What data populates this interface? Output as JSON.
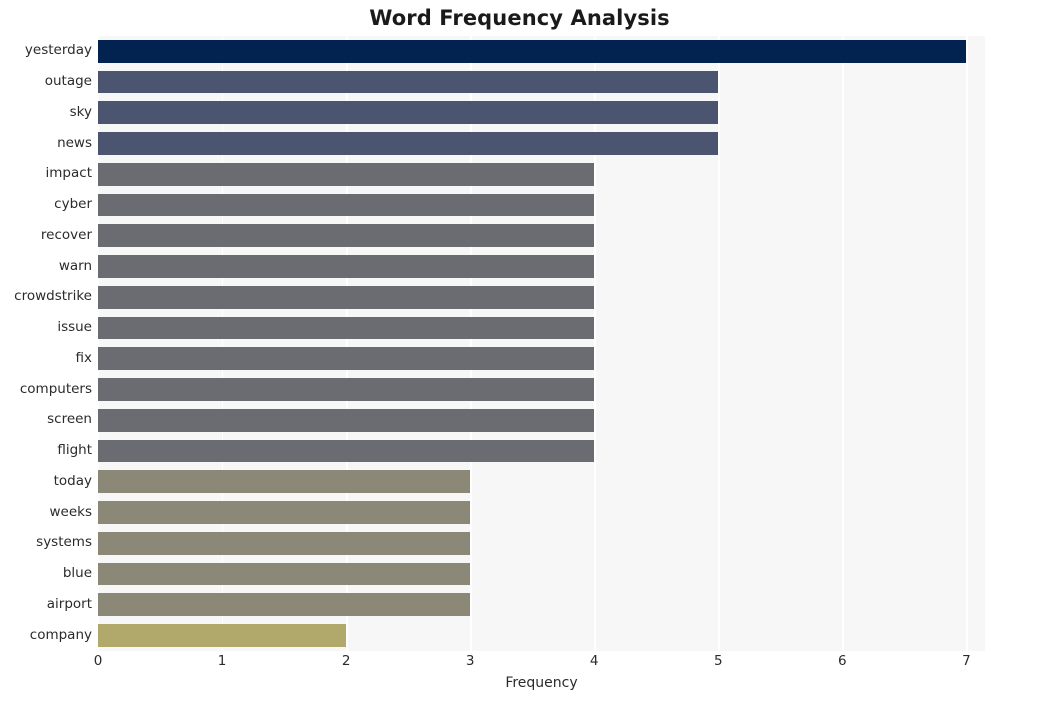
{
  "chart_data": {
    "type": "bar",
    "orientation": "horizontal",
    "title": "Word Frequency Analysis",
    "xlabel": "Frequency",
    "ylabel": "",
    "xlim": [
      0,
      7.15
    ],
    "xticks": [
      "0",
      "1",
      "2",
      "3",
      "4",
      "5",
      "6",
      "7"
    ],
    "xtick_values": [
      0,
      1,
      2,
      3,
      4,
      5,
      6,
      7
    ],
    "grid": "vertical-white",
    "legend": "none",
    "plot_background": "#f7f7f7",
    "categories": [
      "yesterday",
      "outage",
      "sky",
      "news",
      "impact",
      "cyber",
      "recover",
      "warn",
      "crowdstrike",
      "issue",
      "fix",
      "computers",
      "screen",
      "flight",
      "today",
      "weeks",
      "systems",
      "blue",
      "airport",
      "company"
    ],
    "values": [
      7,
      5,
      5,
      5,
      4,
      4,
      4,
      4,
      4,
      4,
      4,
      4,
      4,
      4,
      3,
      3,
      3,
      3,
      3,
      2
    ],
    "bar_colors": [
      "#02234f",
      "#4c5570",
      "#4c5570",
      "#4c5570",
      "#6a6c71",
      "#6a6c71",
      "#6a6c71",
      "#6a6c71",
      "#6a6c71",
      "#6a6c71",
      "#6a6c71",
      "#6a6c71",
      "#6a6c71",
      "#6a6c71",
      "#8c8878",
      "#8c8878",
      "#8c8878",
      "#8c8878",
      "#8c8878",
      "#b1a86b"
    ]
  }
}
